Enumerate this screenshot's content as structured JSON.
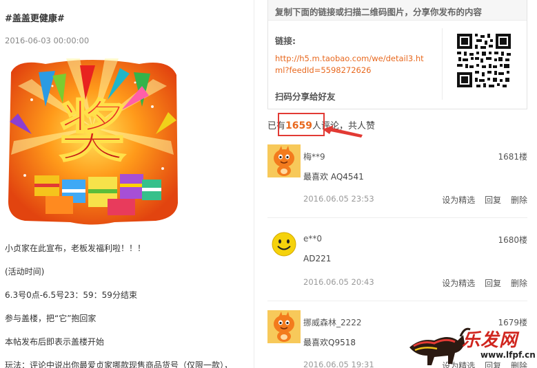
{
  "post": {
    "title": "#盖盖更健康#",
    "date": "2016-06-03 00:00:00",
    "banner_text": "奖",
    "lines": [
      "小贞家在此宣布，老板发福利啦！！！",
      "(活动时间)",
      "6.3号0点-6.5号23：59：59分结束",
      "参与盖楼，把“它”抱回家",
      "本帖发布后即表示盖楼开始",
      "玩法：评论中说出你最爱贞家哪款现售商品货号（仅限一款），"
    ]
  },
  "share": {
    "header": "复制下面的链接或扫描二维码图片，分享你发布的内容",
    "link_label": "链接:",
    "link": "http://h5.m.taobao.com/we/detail3.html?feedId=5598272626",
    "qr_label": "扫码分享给好友"
  },
  "comment_summary": {
    "prefix": "已有",
    "count": "1659",
    "suffix": "人评论，共人赞"
  },
  "comments": [
    {
      "user": "梅**9",
      "floor": "1681楼",
      "text": "最喜欢 AQ4541",
      "time": "2016.06.05 23:53",
      "avatar": "taobao-mascot-icon"
    },
    {
      "user": "e**0",
      "floor": "1680楼",
      "text": "AD221",
      "time": "2016.06.05 20:43",
      "avatar": "smiley-face-icon"
    },
    {
      "user": "挪威森林_2222",
      "floor": "1679楼",
      "text": "最喜欢Q9518",
      "time": "2016.06.05 19:31",
      "avatar": "taobao-mascot-icon"
    }
  ],
  "actions": {
    "set_featured": "设为精选",
    "reply": "回复",
    "delete": "删除"
  },
  "watermark": {
    "brand": "乐发网",
    "url": "www.lfpf.cn"
  },
  "colors": {
    "accent": "#e8681e",
    "annotation_red": "#e23a34"
  }
}
